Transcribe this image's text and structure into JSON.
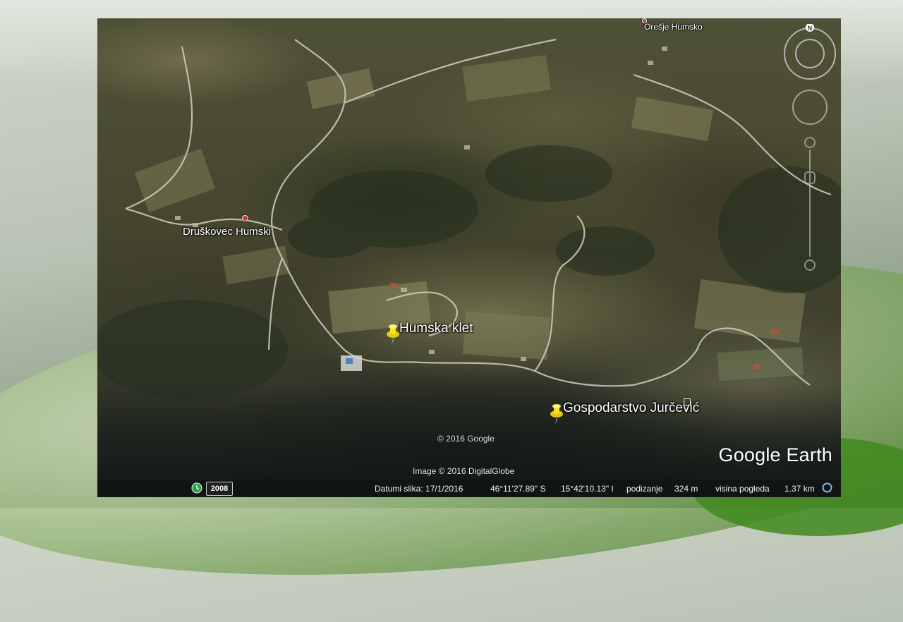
{
  "places": {
    "oresje": "Orešje Humsko",
    "druskovec": "Druškovec Humski",
    "humska_klet": "Humska klet",
    "gospodarstvo": "Gospodarstvo Jurčević"
  },
  "attribution": {
    "google": "© 2016 Google",
    "imagery": "Image © 2016 DigitalGlobe",
    "logo": "Google Earth"
  },
  "nav": {
    "north_label": "N"
  },
  "statusbar": {
    "year": "2008",
    "image_date": "Datumi slika: 17/1/2016",
    "latitude": "46°11'27.89\" S",
    "longitude": "15°42'10.13\" I",
    "elevation_label": "podizanje",
    "elevation": "324 m",
    "eye_alt_label": "visina pogleda",
    "eye_alt": "1.37 km"
  },
  "colors": {
    "pin": "#f5e21a",
    "place_dot": "#c0392b"
  },
  "icons": {
    "pins": "pushpin-icon",
    "history": "historical-imagery-icon",
    "globe": "streaming-globe-icon"
  }
}
